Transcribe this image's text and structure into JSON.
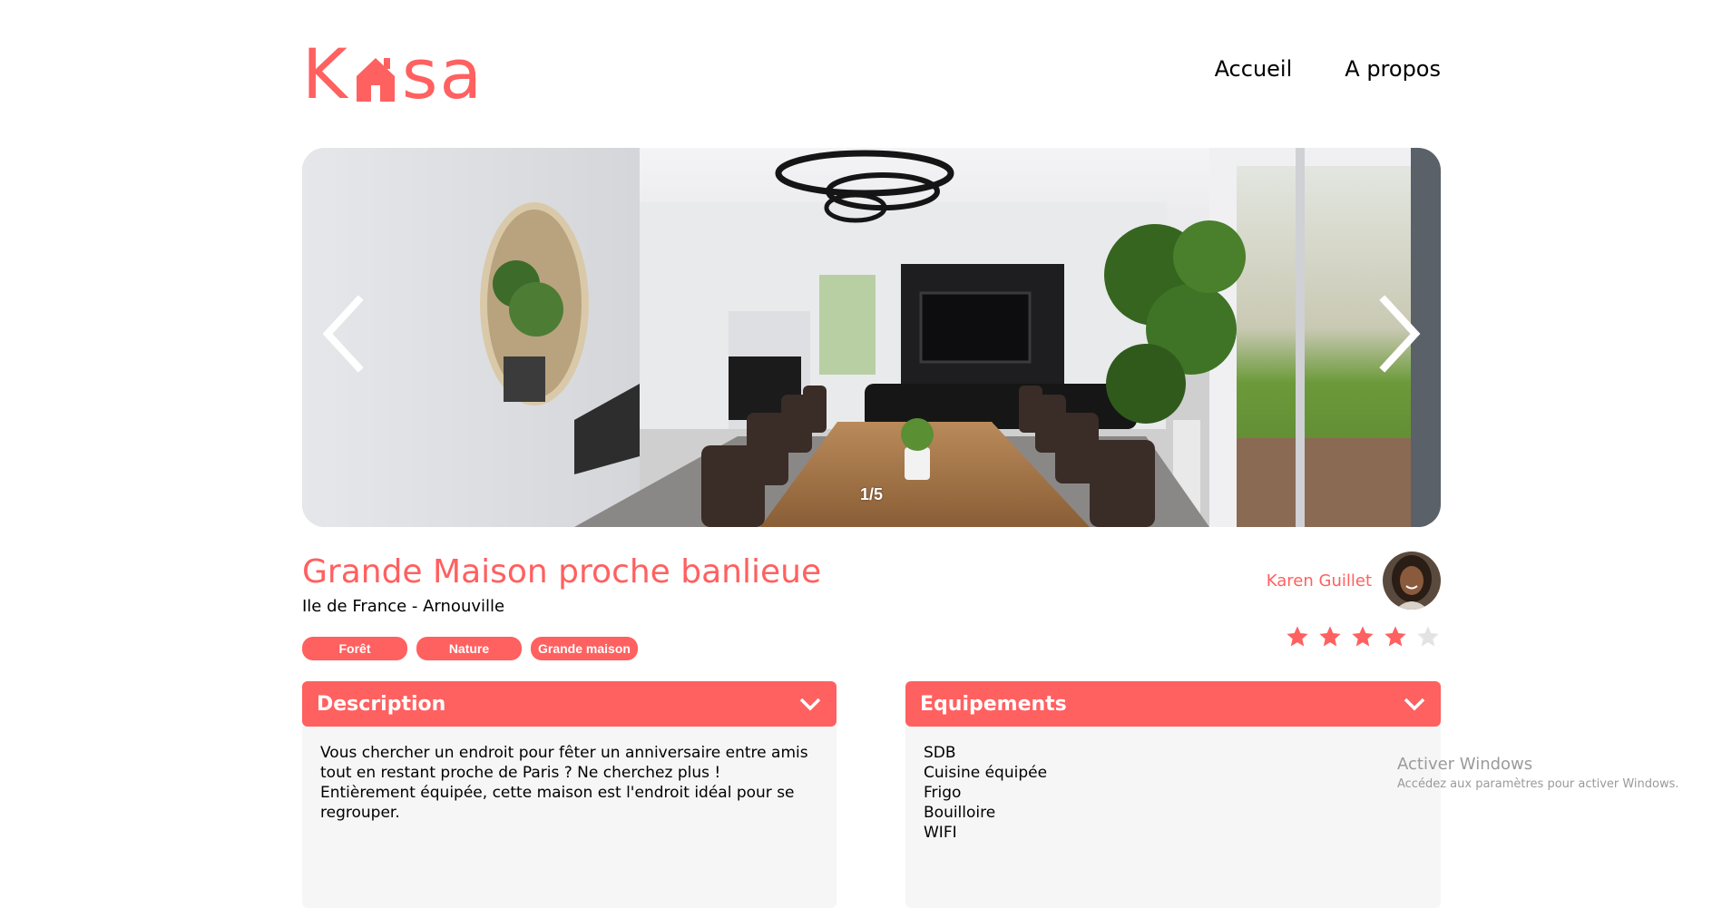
{
  "header": {
    "logo_letters": [
      "K",
      "s",
      "a"
    ],
    "logo_text": "Kasa",
    "nav": [
      "Accueil",
      "A propos"
    ]
  },
  "carousel": {
    "counter": "1/5",
    "prev_icon": "chevron-left-icon",
    "next_icon": "chevron-right-icon"
  },
  "listing": {
    "title": "Grande Maison proche banlieue",
    "location": "Ile de France - Arnouville",
    "tags": [
      "Forêt",
      "Nature",
      "Grande maison"
    ],
    "host_name": "Karen Guillet",
    "rating": 4,
    "rating_max": 5
  },
  "description": {
    "title": "Description",
    "text": "Vous chercher un endroit pour fêter un anniversaire entre amis tout en restant proche de Paris ? Ne cherchez plus ! Entièrement équipée, cette maison est l'endroit idéal pour se regrouper."
  },
  "equipments": {
    "title": "Equipements",
    "items": [
      "SDB",
      "Cuisine équipée",
      "Frigo",
      "Bouilloire",
      "WIFI"
    ]
  },
  "windows_watermark": {
    "line1": "Activer Windows",
    "line2": "Accédez aux paramètres pour activer Windows."
  },
  "colors": {
    "accent": "#ff6060",
    "panel_bg": "#f6f6f6",
    "star_empty": "#e3e3e3"
  }
}
